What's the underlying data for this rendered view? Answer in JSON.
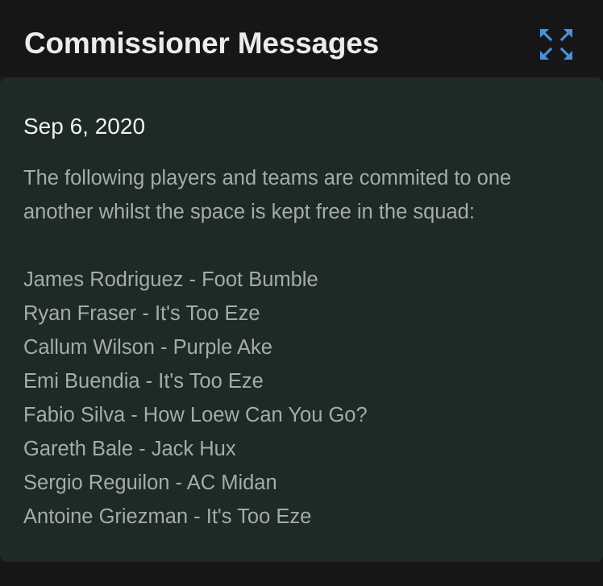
{
  "header": {
    "title": "Commissioner Messages",
    "expand_icon": "expand-arrows-icon",
    "icon_color": "#4a90d9"
  },
  "message": {
    "date": "Sep 6, 2020",
    "intro_lines": [
      "The following players and teams are commited to one",
      "another whilst the space is kept free in the squad:"
    ],
    "commitments": [
      "James Rodriguez - Foot Bumble",
      "Ryan Fraser - It's Too Eze",
      "Callum Wilson - Purple Ake",
      "Emi Buendia - It's Too Eze",
      "Fabio Silva - How Loew Can You Go?",
      "Gareth Bale - Jack Hux",
      "Sergio Reguilon - AC Midan",
      "Antoine Griezman - It's Too Eze"
    ]
  },
  "colors": {
    "page_background": "#161619",
    "card_background": "#1d2a27",
    "title_text": "#ececec",
    "date_text": "#f1f1f1",
    "body_text": "#a5acaa",
    "accent": "#4a90d9"
  }
}
